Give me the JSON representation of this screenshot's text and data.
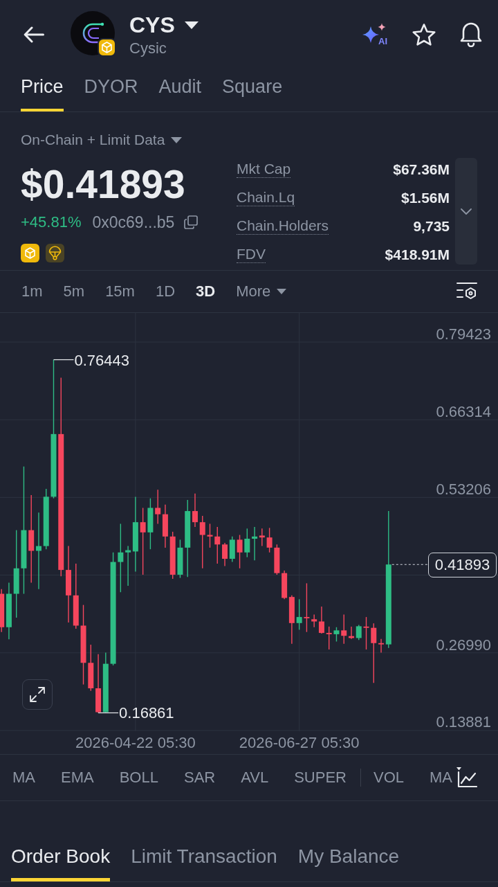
{
  "header": {
    "symbol": "CYS",
    "name": "Cysic",
    "ai_label": "AI"
  },
  "tabs": [
    {
      "label": "Price",
      "selected": true
    },
    {
      "label": "DYOR",
      "selected": false
    },
    {
      "label": "Audit",
      "selected": false
    },
    {
      "label": "Square",
      "selected": false
    }
  ],
  "market": {
    "source": "On-Chain + Limit Data",
    "price": "$0.41893",
    "change": "+45.81%",
    "address": "0x0c69...b5",
    "stats": [
      {
        "label": "Mkt Cap",
        "value": "$67.36M"
      },
      {
        "label": "Chain.Lq",
        "value": "$1.56M"
      },
      {
        "label": "Chain.Holders",
        "value": "9,735"
      },
      {
        "label": "FDV",
        "value": "$418.91M"
      }
    ]
  },
  "intervals": [
    {
      "label": "1m",
      "selected": false
    },
    {
      "label": "5m",
      "selected": false
    },
    {
      "label": "15m",
      "selected": false
    },
    {
      "label": "1D",
      "selected": false
    },
    {
      "label": "3D",
      "selected": true
    }
  ],
  "more": "More",
  "chart": {
    "chart_data": {
      "type": "candlestick",
      "categories": [
        null,
        null,
        null,
        null,
        null,
        null,
        null,
        null,
        null,
        null,
        null,
        null,
        null,
        null,
        null,
        null,
        null,
        null,
        "2026-04-22 05:30",
        null,
        null,
        null,
        null,
        null,
        null,
        null,
        null,
        null,
        null,
        null,
        null,
        null,
        null,
        null,
        null,
        null,
        null,
        null,
        null,
        null,
        "2026-06-27 05:30",
        null,
        null,
        null,
        null,
        null,
        null,
        null,
        null,
        null,
        null,
        null,
        null
      ],
      "ohlc": [
        [
          0.36949,
          0.37755,
          0.30507,
          0.31312
        ],
        [
          0.31312,
          0.38829,
          0.29272,
          0.36949
        ],
        [
          0.36949,
          0.47688,
          0.32923,
          0.41245
        ],
        [
          0.41245,
          0.58426,
          0.36949,
          0.47688
        ],
        [
          0.47688,
          0.53594,
          0.38829,
          0.44198
        ],
        [
          0.44198,
          0.50641,
          0.37755,
          0.45003
        ],
        [
          0.45003,
          0.54668,
          0.44466,
          0.53325
        ],
        [
          0.53325,
          0.76443,
          0.53057,
          0.63902
        ],
        [
          0.63902,
          0.73406,
          0.39903,
          0.40976
        ],
        [
          0.40976,
          0.45003,
          0.32117,
          0.36681
        ],
        [
          0.36681,
          0.4205,
          0.31044,
          0.31581
        ],
        [
          0.31581,
          0.3507,
          0.21648,
          0.25299
        ],
        [
          0.25299,
          0.2836,
          0.20574,
          0.21003
        ],
        [
          0.21003,
          0.26749,
          0.16861,
          0.16976
        ],
        [
          0.16976,
          0.27017,
          0.16976,
          0.25138
        ],
        [
          0.25138,
          0.43929,
          0.24869,
          0.42319
        ],
        [
          0.42319,
          0.48762,
          0.37218,
          0.43929
        ],
        [
          0.43929,
          0.45003,
          0.38292,
          0.44305
        ],
        [
          0.44091,
          0.53325,
          0.40708,
          0.4903
        ],
        [
          0.4903,
          0.51446,
          0.40171,
          0.47312
        ],
        [
          0.47312,
          0.53057,
          0.44466,
          0.51446
        ],
        [
          0.51446,
          0.54507,
          0.48762,
          0.50372
        ],
        [
          0.50372,
          0.51983,
          0.44735,
          0.46614
        ],
        [
          0.46614,
          0.47419,
          0.39473,
          0.40171
        ],
        [
          0.40171,
          0.46077,
          0.39634,
          0.44735
        ],
        [
          0.44735,
          0.52789,
          0.39795,
          0.50909
        ],
        [
          0.50909,
          0.53862,
          0.48225,
          0.4903
        ],
        [
          0.4903,
          0.50104,
          0.41245,
          0.46882
        ],
        [
          0.46882,
          0.48762,
          0.44735,
          0.46614
        ],
        [
          0.46614,
          0.48225,
          0.4205,
          0.45272
        ],
        [
          0.45272,
          0.4554,
          0.41621,
          0.42856
        ],
        [
          0.42856,
          0.46614,
          0.42319,
          0.46077
        ],
        [
          0.46077,
          0.46882,
          0.41245,
          0.43929
        ],
        [
          0.43929,
          0.47956,
          0.43124,
          0.46238
        ],
        [
          0.46238,
          0.48225,
          0.42587,
          0.46614
        ],
        [
          0.46775,
          0.47956,
          0.45003,
          0.46453
        ],
        [
          0.46453,
          0.48064,
          0.43929,
          0.44735
        ],
        [
          0.44735,
          0.45272,
          0.40171,
          0.4044
        ],
        [
          0.4044,
          0.40869,
          0.36036,
          0.36251
        ],
        [
          0.36412,
          0.36681,
          0.28521,
          0.3201
        ],
        [
          0.3201,
          0.36036,
          0.30883,
          0.3303
        ],
        [
          0.3303,
          0.38721,
          0.30507,
          0.32816
        ],
        [
          0.32654,
          0.33461,
          0.31312,
          0.32279
        ],
        [
          0.32279,
          0.34801,
          0.30238,
          0.30346
        ],
        [
          0.30346,
          0.3142,
          0.27554,
          0.30131
        ],
        [
          0.30131,
          0.31312,
          0.28896,
          0.30775
        ],
        [
          0.30775,
          0.33461,
          0.28521,
          0.29862
        ],
        [
          0.29809,
          0.3142,
          0.29326,
          0.29487
        ],
        [
          0.29487,
          0.31688,
          0.29165,
          0.31474
        ],
        [
          0.3142,
          0.3303,
          0.27554,
          0.31205
        ],
        [
          0.31205,
          0.31957,
          0.21916,
          0.28628
        ],
        [
          0.28628,
          0.29326,
          0.27017,
          0.28413
        ],
        [
          0.28413,
          0.50909,
          0.27823,
          0.41893
        ]
      ],
      "ylim": [
        0.13764,
        0.8433
      ],
      "yticks": [
        {
          "value": 0.79423,
          "label": "0.79423"
        },
        {
          "value": 0.66314,
          "label": "0.66314"
        },
        {
          "value": 0.53206,
          "label": "0.53206"
        },
        {
          "value": 0.2699,
          "label": "0.26990"
        },
        {
          "value": 0.13881,
          "label": "0.13881"
        }
      ],
      "grid": true,
      "annotations": [
        "0.76443",
        "0.16861"
      ],
      "ref_lines": [
        {
          "axis": "y",
          "value": 0.41893,
          "label": "0.41893"
        }
      ]
    }
  },
  "indicators": {
    "main": [
      "MA",
      "EMA",
      "BOLL",
      "SAR",
      "AVL",
      "SUPER"
    ],
    "sub": [
      "VOL",
      "MA"
    ]
  },
  "bottom_tabs": [
    {
      "label": "Order Book",
      "selected": true
    },
    {
      "label": "Limit Transaction",
      "selected": false
    },
    {
      "label": "My Balance",
      "selected": false
    }
  ]
}
